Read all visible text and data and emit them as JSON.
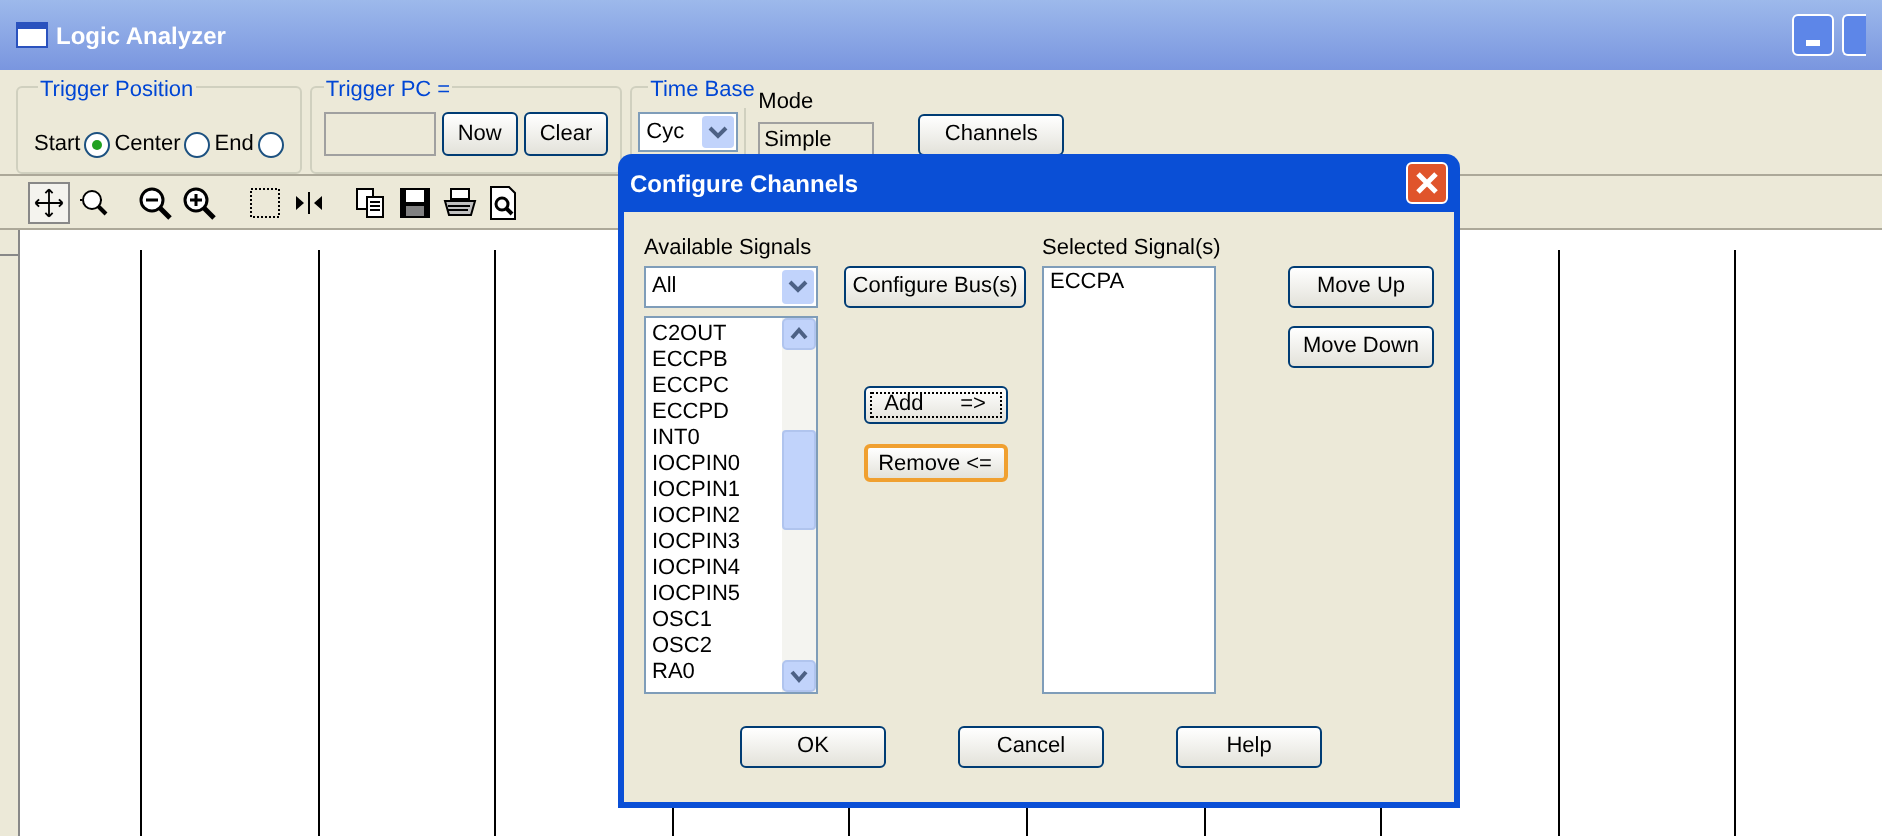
{
  "window": {
    "title": "Logic Analyzer"
  },
  "trigger_position": {
    "label": "Trigger Position",
    "options": [
      {
        "label": "Start",
        "selected": true
      },
      {
        "label": "Center",
        "selected": false
      },
      {
        "label": "End",
        "selected": false
      }
    ]
  },
  "trigger_pc": {
    "label": "Trigger PC =",
    "buttons": [
      "Now",
      "Clear"
    ]
  },
  "time_base": {
    "label": "Time Base",
    "value": "Cyc"
  },
  "mode": {
    "label": "Mode",
    "value": "Simple"
  },
  "channels_button": "Channels",
  "dialog": {
    "title": "Configure Channels",
    "available": {
      "label": "Available Signals",
      "filter": "All",
      "items": [
        "C2OUT",
        "ECCPB",
        "ECCPC",
        "ECCPD",
        "INT0",
        "IOCPIN0",
        "IOCPIN1",
        "IOCPIN2",
        "IOCPIN3",
        "IOCPIN4",
        "IOCPIN5",
        "OSC1",
        "OSC2",
        "RA0"
      ]
    },
    "configure_bus": "Configure Bus(s)",
    "add": "Add      =>",
    "remove": "Remove <=",
    "selected": {
      "label": "Selected Signal(s)",
      "items": [
        "ECCPA"
      ]
    },
    "move_up": "Move Up",
    "move_down": "Move Down",
    "buttons": [
      "OK",
      "Cancel",
      "Help"
    ]
  }
}
